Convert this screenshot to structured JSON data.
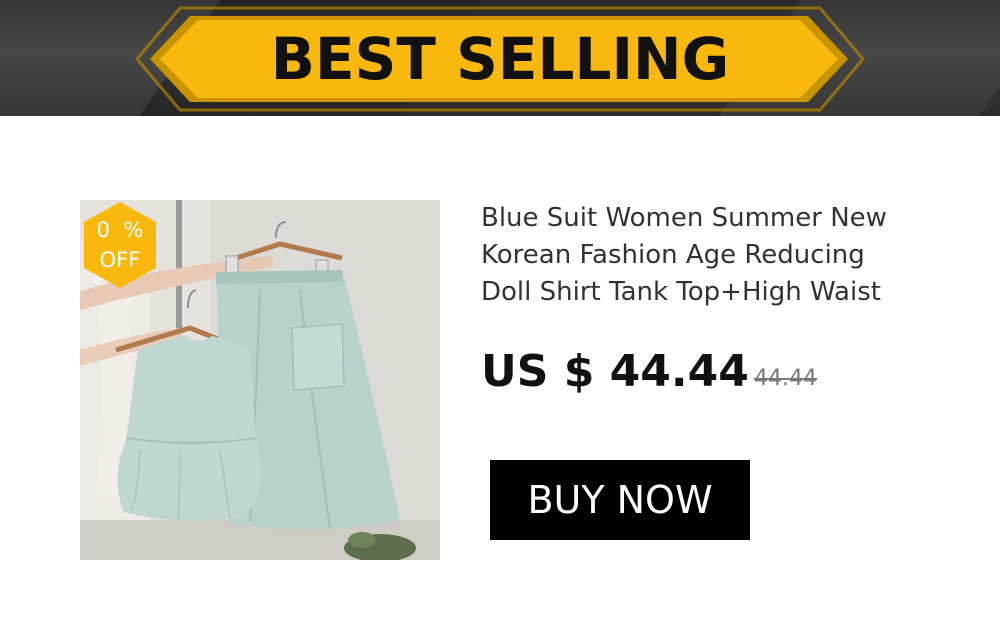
{
  "banner": {
    "title": "BEST SELLING",
    "colors": {
      "ribbon": "#F8B80E",
      "ribbon_shadow": "#C99400",
      "background": "#2F2F2F"
    }
  },
  "product": {
    "image_alt": "Blue suit: sleeveless peplum top and high-waist midi skirt on hangers",
    "discount_badge": {
      "line1": "0  %",
      "line2": "OFF",
      "color": "#F8B80E"
    },
    "title_lines": [
      "Blue Suit Women Summer New",
      "Korean Fashion Age Reducing",
      "Doll Shirt Tank Top+High Waist"
    ],
    "price": "US $ 44.44",
    "original_price": "44.44",
    "buy_label": "BUY NOW"
  }
}
